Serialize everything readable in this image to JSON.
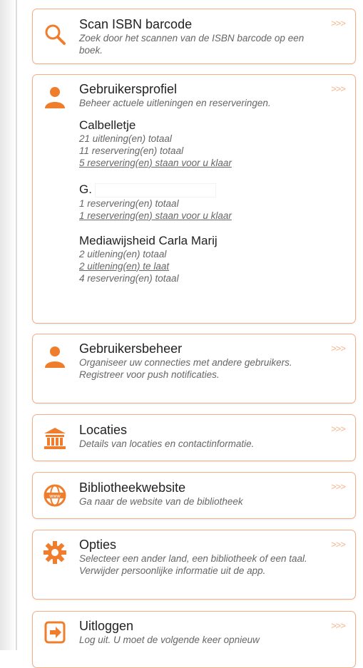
{
  "colors": {
    "accent": "#f07d2c",
    "border": "#f2b088",
    "arrow": "#f6b48e"
  },
  "arrow_label": ">>>",
  "menu": {
    "scan": {
      "title": "Scan ISBN barcode",
      "desc": "Zoek door het scannen van de ISBN barcode op een boek.",
      "icon": "search-icon"
    },
    "profile": {
      "title": "Gebruikersprofiel",
      "desc": "Beheer actuele uitleningen en reserveringen.",
      "icon": "user-icon",
      "accounts": [
        {
          "name": "Calbelletje",
          "lines": [
            "21 uitlening(en) totaal",
            "11 reservering(en) totaal",
            "5 reservering(en) staan voor u klaar"
          ]
        },
        {
          "name": "G.",
          "lines": [
            "1 reservering(en) totaal",
            "1 reservering(en) staan voor u klaar"
          ]
        },
        {
          "name": "Mediawijsheid Carla Marij",
          "lines": [
            "2 uitlening(en) totaal",
            "2 uitlening(en) te laat",
            "4 reservering(en) totaal"
          ]
        }
      ]
    },
    "user_admin": {
      "title": "Gebruikersbeheer",
      "desc": "Organiseer uw connecties met andere gebruikers. Registreer voor push notificaties.",
      "icon": "user-icon"
    },
    "locations": {
      "title": "Locaties",
      "desc": "Details van locaties en contactinformatie.",
      "icon": "building-icon"
    },
    "website": {
      "title": "Bibliotheekwebsite",
      "desc": "Ga naar de website van de bibliotheek",
      "icon": "globe-icon"
    },
    "options": {
      "title": "Opties",
      "desc": "Selecteer een ander land, een bibliotheek of een taal. Verwijder persoonlijke informatie uit de app.",
      "icon": "gear-icon"
    },
    "logout": {
      "title": "Uitloggen",
      "desc": "Log uit. U moet de volgende keer opnieuw",
      "icon": "logout-icon"
    }
  }
}
